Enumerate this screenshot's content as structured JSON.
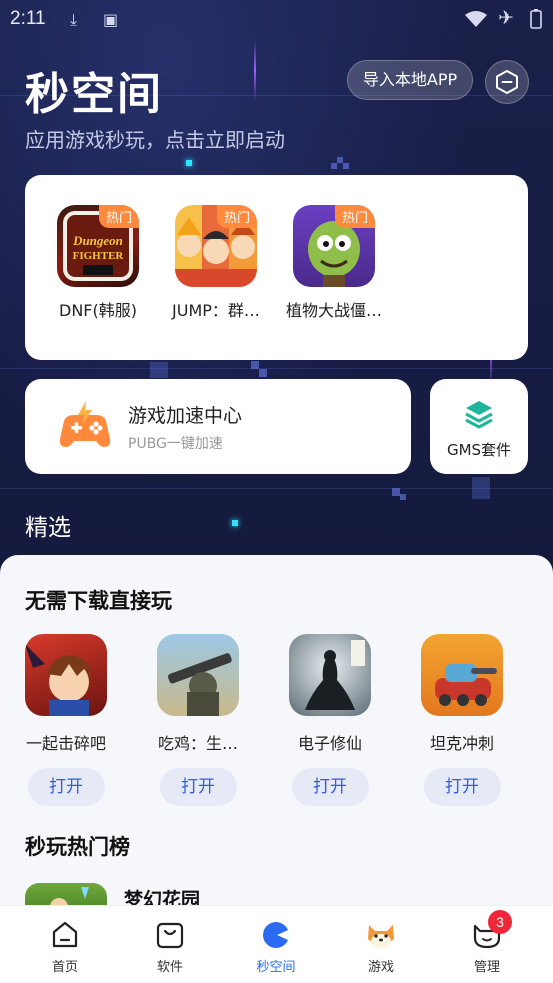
{
  "status_bar": {
    "time": "2:11"
  },
  "header": {
    "title": "秒空间",
    "subtitle": "应用游戏秒玩，点击立即启动",
    "import_button": "导入本地APP",
    "settings_icon": "hexagon-minus-icon"
  },
  "hot_apps": {
    "badge": "热门",
    "items": [
      {
        "label": "DNF(韩服)",
        "icon": "dnf-game-icon"
      },
      {
        "label": "JUMP：群…",
        "icon": "jump-game-icon"
      },
      {
        "label": "植物大战僵…",
        "icon": "pvz-game-icon"
      }
    ]
  },
  "accelerator": {
    "title": "游戏加速中心",
    "subtitle": "PUBG一键加速",
    "icon": "gamepad-lightning-icon"
  },
  "gms": {
    "label": "GMS套件",
    "icon": "layers-icon"
  },
  "featured": {
    "label": "精选"
  },
  "instant_play": {
    "heading": "无需下载直接玩",
    "open_label": "打开",
    "items": [
      {
        "label": "一起击碎吧"
      },
      {
        "label": "吃鸡：生…"
      },
      {
        "label": "电子修仙"
      },
      {
        "label": "坦克冲刺"
      }
    ]
  },
  "ranking": {
    "heading": "秒玩热门榜",
    "first": {
      "name": "梦幻花园"
    }
  },
  "tabbar": {
    "items": [
      {
        "label": "首页",
        "icon": "home-icon"
      },
      {
        "label": "软件",
        "icon": "bag-icon"
      },
      {
        "label": "秒空间",
        "icon": "pacman-icon",
        "active": true
      },
      {
        "label": "游戏",
        "icon": "shiba-icon"
      },
      {
        "label": "管理",
        "icon": "face-icon",
        "badge": "3"
      }
    ]
  },
  "colors": {
    "accent": "#2a6bf2",
    "hot_badge": "#ff8a3d",
    "open_button_text": "#3b5bd6",
    "badge_red": "#f0263a"
  }
}
